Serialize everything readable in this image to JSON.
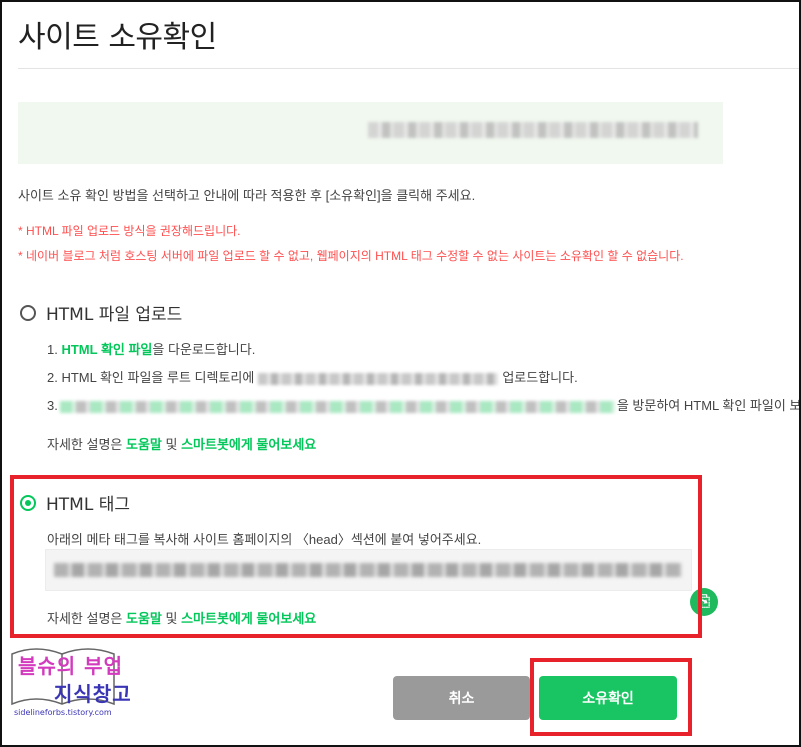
{
  "page": {
    "title": "사이트 소유확인"
  },
  "site": {
    "url": "·········· ·············· ·········"
  },
  "intro": "사이트 소유 확인 방법을 선택하고 안내에 따라 적용한 후 [소유확인]을 클릭해 주세요.",
  "notices": [
    "* HTML 파일 업로드 방식을 권장해드립니다.",
    "* 네이버 블로그 처럼 호스팅 서버에 파일 업로드 할 수 없고, 웹페이지의 HTML 태그 수정할 수 없는 사이트는 소유확인 할 수 없습니다."
  ],
  "options": {
    "file_upload": {
      "label": "HTML 파일 업로드",
      "selected": false,
      "step1_prefix": "1. ",
      "step1_link": "HTML 확인 파일",
      "step1_suffix": "을 다운로드합니다.",
      "step2_prefix": "2. HTML 확인 파일을 루트 디렉토리에",
      "step2_suffix": "업로드합니다.",
      "step3_prefix": "3.",
      "step3_suffix": "을 방문하여 HTML 확인 파일이 보"
    },
    "html_tag": {
      "label": "HTML 태그",
      "selected": true,
      "description": "아래의 메타 태그를 복사해 사이트 홈페이지의 〈head〉섹션에 붙여 넣어주세요."
    }
  },
  "help": {
    "prefix": "자세한 설명은 ",
    "link1": "도움말",
    "middle": " 및 ",
    "link2": "스마트봇에게 물어보세요"
  },
  "buttons": {
    "cancel": "취소",
    "confirm": "소유확인"
  },
  "watermark": {
    "line1": "블슈의 부업",
    "line2": "지식창고",
    "url": "sidelineforbs.tistory.com"
  },
  "colors": {
    "accent": "#03c75a",
    "warning": "#ff4e4e",
    "highlight": "#e8222b"
  }
}
